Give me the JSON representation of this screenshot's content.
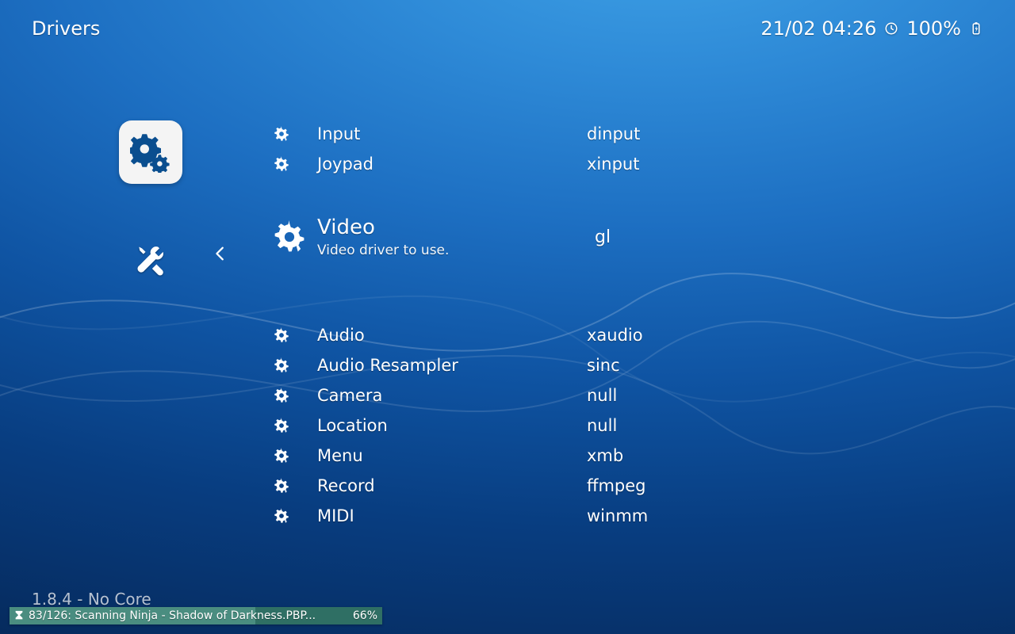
{
  "header": {
    "title": "Drivers",
    "datetime": "21/02 04:26",
    "battery": "100%"
  },
  "selected": {
    "label": "Video",
    "hint": "Video driver to use.",
    "value": "gl"
  },
  "above": [
    {
      "label": "Input",
      "value": "dinput"
    },
    {
      "label": "Joypad",
      "value": "xinput"
    }
  ],
  "below": [
    {
      "label": "Audio",
      "value": "xaudio"
    },
    {
      "label": "Audio Resampler",
      "value": "sinc"
    },
    {
      "label": "Camera",
      "value": "null"
    },
    {
      "label": "Location",
      "value": "null"
    },
    {
      "label": "Menu",
      "value": "xmb"
    },
    {
      "label": "Record",
      "value": "ffmpeg"
    },
    {
      "label": "MIDI",
      "value": "winmm"
    }
  ],
  "version": "1.8.4 - No Core",
  "progress": {
    "text": "83/126: Scanning Ninja - Shadow of Darkness.PBP...",
    "percent_label": "66%",
    "percent": 66
  }
}
